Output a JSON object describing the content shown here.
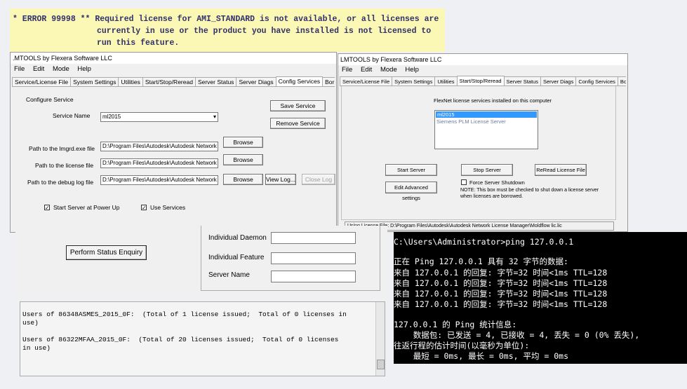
{
  "error_banner": {
    "line1": "* ERROR 99998 ** Required license for AMI_STANDARD is not available, or all licenses are",
    "line2": "currently in use or the product you have installed is not licensed to",
    "line3": "run this feature."
  },
  "window_left": {
    "title": ".MTOOLS by Flexera Software LLC",
    "menu": [
      "File",
      "Edit",
      "Mode",
      "Help"
    ],
    "tabs": [
      "Service/License File",
      "System Settings",
      "Utilities",
      "Start/Stop/Reread",
      "Server Status",
      "Server Diags",
      "Config Services",
      "Borrowing"
    ],
    "active_tab": "Config Services",
    "configure_service_label": "Configure Service",
    "service_name_label": "Service Name",
    "service_name_value": "ml2015",
    "save_service": "Save Service",
    "remove_service": "Remove Service",
    "lmgrd_label": "Path to the lmgrd.exe file",
    "lmgrd_value": "D:\\Program Files\\Autodesk\\Autodesk Network L",
    "license_label": "Path to the license file",
    "license_value": "D:\\Program Files\\Autodesk\\Autodesk Network L",
    "debug_label": "Path to the debug log file",
    "debug_value": "D:\\Program Files\\Autodesk\\Autodesk Network L",
    "browse": "Browse",
    "view_log": "View Log...",
    "close_log": "Close Log",
    "start_at_powerup": "Start Server at Power Up",
    "use_services": "Use Services"
  },
  "window_right": {
    "title": "LMTOOLS by Flexera Software LLC",
    "menu": [
      "File",
      "Edit",
      "Mode",
      "Help"
    ],
    "tabs": [
      "Service/License File",
      "System Settings",
      "Utilities",
      "Start/Stop/Reread",
      "Server Status",
      "Server Diags",
      "Config Services",
      "Borrowing"
    ],
    "active_tab": "Start/Stop/Reread",
    "flexnet_label": "FlexNet license services installed on this computer",
    "services": [
      "ml2015",
      "Siemens PLM License Server"
    ],
    "start_server": "Start Server",
    "stop_server": "Stop Server",
    "reread": "ReRead License File",
    "edit_advanced": "Edit Advanced settings",
    "force_shutdown": "Force Server Shutdown",
    "note_line1": "NOTE:  This box must be checked to shut down a license server",
    "note_line2": "when licenses are borrowed.",
    "status_bar": "Using License File:  D:\\Program Files\\Autodesk\\Autodesk Network License Manager\\Moldflow lic.lic"
  },
  "status_panel": {
    "perform": "Perform Status Enquiry",
    "individual_daemon": "Individual Daemon",
    "individual_feature": "Individual Feature",
    "server_name": "Server Name"
  },
  "usage": {
    "line1": "Users of 86348ASMES_2015_0F:  (Total of 1 license issued;  Total of 0 licenses in",
    "line2": "use)",
    "line3": "Users of 86322MFAA_2015_0F:  (Total of 20 licenses issued;  Total of 0 licenses",
    "line4": "in use)"
  },
  "terminal": {
    "lines": [
      "C:\\Users\\Administrator>ping 127.0.0.1",
      "",
      "正在 Ping 127.0.0.1 具有 32 字节的数据:",
      "来自 127.0.0.1 的回复: 字节=32 时间<1ms TTL=128",
      "来自 127.0.0.1 的回复: 字节=32 时间<1ms TTL=128",
      "来自 127.0.0.1 的回复: 字节=32 时间<1ms TTL=128",
      "来自 127.0.0.1 的回复: 字节=32 时间<1ms TTL=128",
      "",
      "127.0.0.1 的 Ping 统计信息:",
      "    数据包: 已发送 = 4, 已接收 = 4, 丢失 = 0 (0% 丢失),",
      "往返行程的估计时间(以毫秒为单位):",
      "    最短 = 0ms, 最长 = 0ms, 平均 = 0ms"
    ]
  },
  "colors": {
    "terminal_bg": "#000000",
    "banner_bg": "#fbf7b4",
    "selection": "#3399ff"
  }
}
